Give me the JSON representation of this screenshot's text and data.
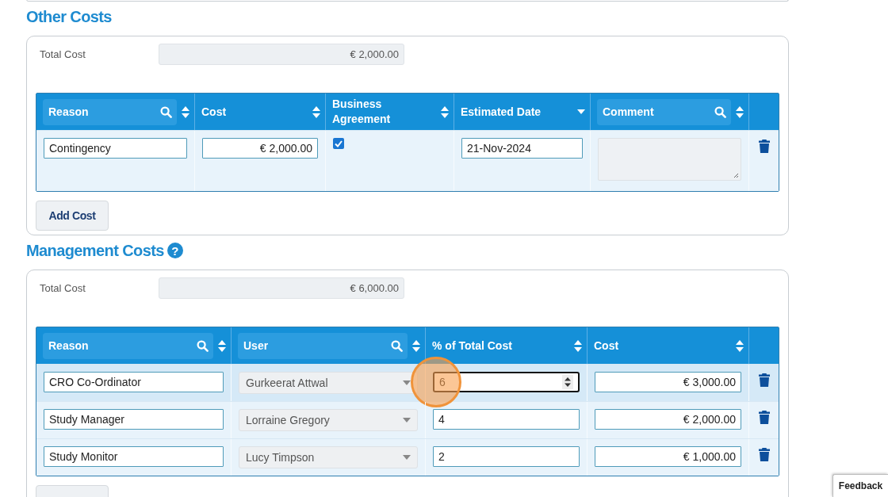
{
  "sections": [
    {
      "title": "Other Costs",
      "total": {
        "label": "Total Cost",
        "value": "€ 2,000.00"
      },
      "columns": [
        {
          "label": "Reason",
          "kind": "search-sort"
        },
        {
          "label": "Cost",
          "kind": "sort"
        },
        {
          "label": "Business Agreement",
          "kind": "sort"
        },
        {
          "label": "Estimated Date",
          "kind": "sort-down"
        },
        {
          "label": "Comment",
          "kind": "search-sort"
        }
      ],
      "rows": [
        {
          "selected": false,
          "cells": [
            {
              "kind": "text",
              "value": "Contingency"
            },
            {
              "kind": "money",
              "value": "€ 2,000.00"
            },
            {
              "kind": "checkbox",
              "checked": true
            },
            {
              "kind": "text",
              "value": "21-Nov-2024"
            },
            {
              "kind": "textarea"
            }
          ]
        }
      ],
      "add_button": "Add Cost"
    },
    {
      "title": "Management Costs",
      "help": "?",
      "total": {
        "label": "Total Cost",
        "value": "€ 6,000.00"
      },
      "columns": [
        {
          "label": "Reason",
          "kind": "search-sort"
        },
        {
          "label": "User",
          "kind": "search-sort"
        },
        {
          "label": "% of Total Cost",
          "kind": "sort"
        },
        {
          "label": "Cost",
          "kind": "sort"
        }
      ],
      "rows": [
        {
          "selected": true,
          "cells": [
            {
              "kind": "text",
              "value": "CRO Co-Ordinator"
            },
            {
              "kind": "select",
              "value": "Gurkeerat Attwal"
            },
            {
              "kind": "number",
              "value": "6",
              "focused": true,
              "clicked": true
            },
            {
              "kind": "money",
              "value": "€ 3,000.00"
            }
          ]
        },
        {
          "selected": false,
          "cells": [
            {
              "kind": "text",
              "value": "Study Manager"
            },
            {
              "kind": "select",
              "value": "Lorraine Gregory"
            },
            {
              "kind": "number",
              "value": "4",
              "focused": false,
              "clicked": false
            },
            {
              "kind": "money",
              "value": "€ 2,000.00"
            }
          ]
        },
        {
          "selected": false,
          "cells": [
            {
              "kind": "text",
              "value": "Study Monitor"
            },
            {
              "kind": "select",
              "value": "Lucy Timpson"
            },
            {
              "kind": "number",
              "value": "2",
              "focused": false,
              "clicked": false
            },
            {
              "kind": "money",
              "value": "€ 1,000.00"
            }
          ]
        }
      ]
    }
  ],
  "feedback": "Feedback"
}
